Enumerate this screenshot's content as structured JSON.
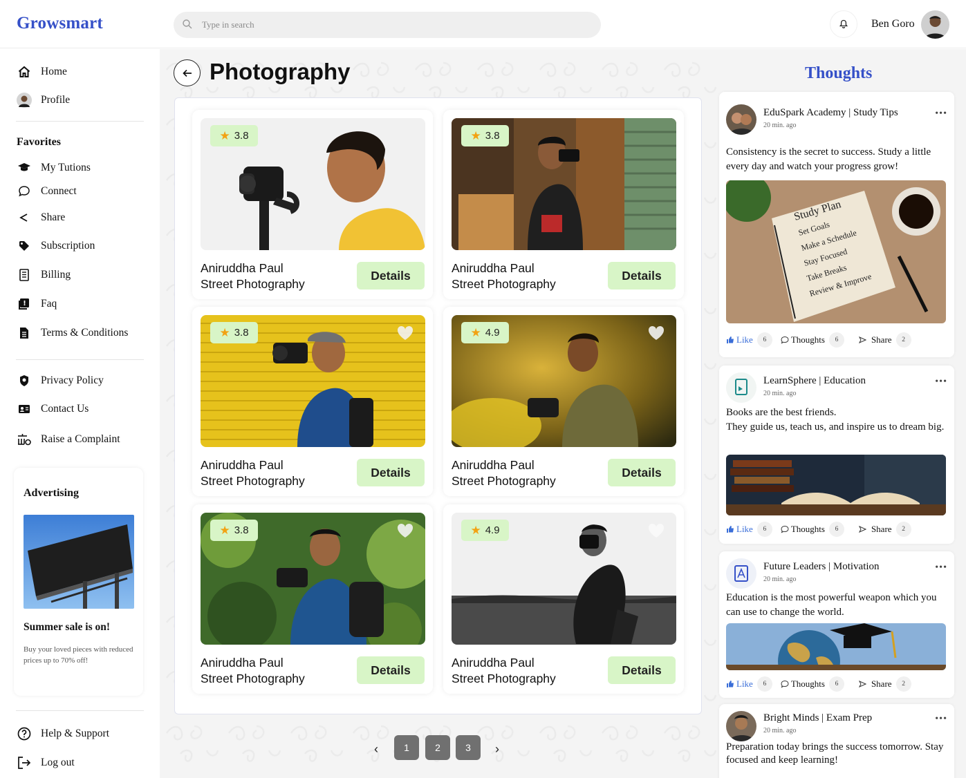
{
  "app": {
    "logo": "Growsmart"
  },
  "header": {
    "search_placeholder": "Type in search",
    "user_name": "Ben Goro"
  },
  "sidebar": {
    "top_items": [
      {
        "label": "Home",
        "icon": "home-icon"
      },
      {
        "label": "Profile",
        "icon": "avatar"
      }
    ],
    "favorites_title": "Favorites",
    "favorites": [
      {
        "label": "My Tutions",
        "icon": "graduation-cap-icon"
      },
      {
        "label": "Connect",
        "icon": "chat-bubble-icon"
      },
      {
        "label": "Share",
        "icon": "share-icon"
      },
      {
        "label": "Subscription",
        "icon": "tag-icon"
      },
      {
        "label": "Billing",
        "icon": "receipt-icon"
      },
      {
        "label": "Faq",
        "icon": "faq-icon"
      },
      {
        "label": "Terms & Conditions",
        "icon": "document-icon"
      }
    ],
    "policy_items": [
      {
        "label": "Privacy Policy",
        "icon": "shield-icon"
      },
      {
        "label": "Contact Us",
        "icon": "contact-card-icon"
      },
      {
        "label": "Raise a Complaint",
        "icon": "complaint-icon"
      }
    ],
    "ad": {
      "title": "Advertising",
      "headline": "Summer sale is on!",
      "text": "Buy your loved pieces with reduced prices up to 70% off!"
    },
    "bottom_items": [
      {
        "label": "Help & Support",
        "icon": "help-icon"
      },
      {
        "label": "Log out",
        "icon": "logout-icon"
      }
    ]
  },
  "main": {
    "title": "Photography",
    "cards": [
      {
        "rating": "3.8",
        "name": "Aniruddha Paul",
        "category": "Street Photography",
        "button": "Details",
        "heart": false
      },
      {
        "rating": "3.8",
        "name": "Aniruddha Paul",
        "category": "Street Photography",
        "button": "Details",
        "heart": false
      },
      {
        "rating": "3.8",
        "name": "Aniruddha Paul",
        "category": "Street Photography",
        "button": "Details",
        "heart": true
      },
      {
        "rating": "4.9",
        "name": "Aniruddha Paul",
        "category": "Street Photography",
        "button": "Details",
        "heart": true
      },
      {
        "rating": "3.8",
        "name": "Aniruddha Paul",
        "category": "Street Photography",
        "button": "Details",
        "heart": true
      },
      {
        "rating": "4.9",
        "name": "Aniruddha Paul",
        "category": "Street Photography",
        "button": "Details",
        "heart": true
      }
    ],
    "pagination": {
      "pages": [
        "1",
        "2",
        "3"
      ],
      "prev": "‹",
      "next": "›"
    }
  },
  "thoughts": {
    "title": "Thoughts",
    "posts": [
      {
        "author": "EduSpark Academy | Study Tips",
        "time": "20 min. ago",
        "text": "Consistency is the secret to success. Study a little every day and watch your progress grow!",
        "image_caption": {
          "title": "Study Plan",
          "items": [
            "Set Goals",
            "Make a Schedule",
            "Stay Focused",
            "Take Breaks",
            "Review & Improve"
          ]
        },
        "like": "Like",
        "likes": "6",
        "thoughts": "Thoughts",
        "thoughts_count": "6",
        "share": "Share",
        "shares": "2"
      },
      {
        "author": "LearnSphere | Education",
        "time": "20 min. ago",
        "text": "Books are the best friends.\nThey guide us, teach us, and inspire us to dream big.",
        "like": "Like",
        "likes": "6",
        "thoughts": "Thoughts",
        "thoughts_count": "6",
        "share": "Share",
        "shares": "2"
      },
      {
        "author": "Future Leaders | Motivation",
        "time": "20 min. ago",
        "text": "Education is the most powerful weapon which you can use to change the world.",
        "like": "Like",
        "likes": "6",
        "thoughts": "Thoughts",
        "thoughts_count": "6",
        "share": "Share",
        "shares": "2"
      },
      {
        "author": "Bright Minds | Exam Prep",
        "time": "20 min. ago",
        "text": "Preparation today brings the success tomorrow. Stay focused and keep learning!"
      }
    ]
  },
  "colors": {
    "brand": "#3550c8",
    "accent_green": "#d8f5c7",
    "star": "#f2a213",
    "like_blue": "#3a6ed8"
  }
}
